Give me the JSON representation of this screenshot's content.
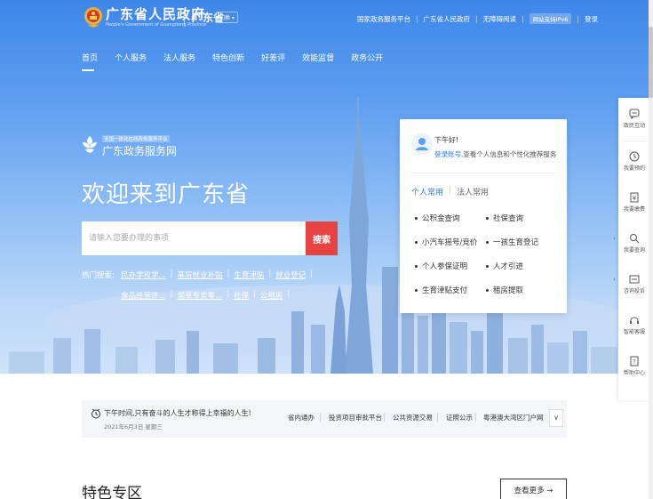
{
  "header": {
    "gov_title": "广东省人民政府",
    "gov_subtitle": "People's Government of Guangdong Province",
    "province": "广东省",
    "switch_label": "切换",
    "top_links": [
      "国家政务服务平台",
      "广东省人民政府",
      "无障碍阅读",
      "网站支持IPv6",
      "登录"
    ]
  },
  "nav": {
    "items": [
      "首页",
      "个人服务",
      "法人服务",
      "特色创新",
      "好差评",
      "效能监督",
      "政务公开"
    ],
    "active": "首页"
  },
  "hero": {
    "brand_small": "全国一体化在线政务服务平台",
    "brand_name": "广东政务服务网",
    "welcome": "欢迎来到广东省"
  },
  "search": {
    "placeholder": "请输入您要办理的事项",
    "button_label": "搜索"
  },
  "hot": {
    "label": "热门搜索:",
    "row1": [
      "民办学校学...",
      "基层就业补贴",
      "生育津贴",
      "就业登记"
    ],
    "row2": [
      "食品经营许...",
      "烟草专卖零...",
      "社保",
      "公租房"
    ]
  },
  "user_card": {
    "greeting": "下午好!",
    "login_link": "登录账号,",
    "login_text": "查看个人信息和个性化推荐服务",
    "tabs": [
      "个人常用",
      "法人常用"
    ],
    "links": [
      "公积金查询",
      "社保查询",
      "小汽车摇号/竞价",
      "一孩生育登记",
      "个人参保证明",
      "人才引进",
      "生育津贴支付",
      "租房提取"
    ]
  },
  "sidetool": {
    "items": [
      "政民互动",
      "我要预约",
      "我要缴费",
      "我要查询",
      "咨询投诉",
      "智能客服",
      "帮助中心"
    ]
  },
  "notice": {
    "text": "下午时间,只有奋斗的人生才称得上幸福的人生!",
    "date": "2021年6月3日 星期三",
    "quick_links": [
      "省内通办",
      "投资项目审批平台",
      "公共资源交易",
      "证照公示",
      "粤港澳大湾区门户网"
    ],
    "more_chevron": "∨"
  },
  "special": {
    "title": "特色专区",
    "view_more": "查看更多 →"
  },
  "colors": {
    "primary_blue": "#3e86e9",
    "search_red": "#e84343",
    "link_blue": "#2f7ce8"
  }
}
